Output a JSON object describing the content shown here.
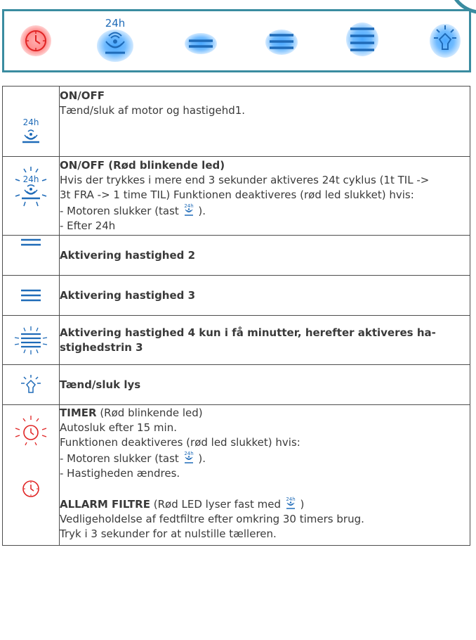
{
  "panel": {
    "icons": [
      "timer-clock-icon",
      "onoff-24h-icon",
      "speed-2-icon",
      "speed-3-icon",
      "speed-4-icon",
      "light-bulb-icon"
    ],
    "badge_24h": "24h",
    "colors": {
      "frame": "#3a8ca0",
      "blue": "#1f6bb8",
      "red": "#e02424"
    }
  },
  "rows": [
    {
      "title": "ON/OFF",
      "text": "Tænd/sluk af motor og hastigehd1."
    },
    {
      "title": "ON/OFF (Rød blinkende led)",
      "line1": "Hvis der trykkes i mere end 3 sekunder aktiveres 24t cyklus (1t TIL ->",
      "line2": "3t FRA -> 1 time TIL) Funktionen deaktiveres (rød led slukket) hvis:",
      "line3_pre": "- Motoren slukker (tast",
      "line3_post": ").",
      "line4": "- Efter 24h"
    },
    {
      "title": "Aktivering hastighed 2"
    },
    {
      "title": "Aktivering hastighed 3"
    },
    {
      "line1": "Aktivering hastighed 4 kun i få minutter, herefter aktiveres ha-",
      "line2": "stighedstrin 3"
    },
    {
      "title": "Tænd/sluk lys"
    },
    {
      "timer_title": "TIMER",
      "timer_sub": "(Rød blinkende led)",
      "line1": "Autosluk efter 15 min.",
      "line2": "Funktionen deaktiveres (rød led slukket) hvis:",
      "line3_pre": "- Motoren slukker (tast",
      "line3_post": ").",
      "line4": "- Hastigheden ændres.",
      "alarm_title": "ALLARM FILTRE",
      "alarm_sub_pre": "(Rød LED lyser fast med",
      "alarm_sub_post": ")",
      "line5": "Vedligeholdelse af fedtfiltre efter omkring 30 timers brug.",
      "line6": "Tryk i 3 sekunder for at nulstille tælleren."
    }
  ],
  "inline_badge": "24h"
}
